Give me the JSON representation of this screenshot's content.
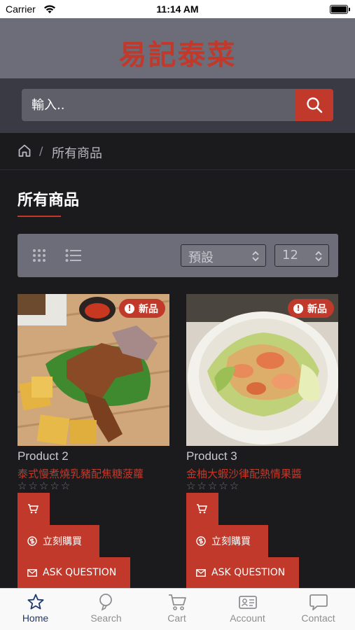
{
  "status_bar": {
    "carrier": "Carrier",
    "time": "11:14 AM"
  },
  "brand": {
    "title": "易記泰菜"
  },
  "search": {
    "placeholder": "輸入.."
  },
  "breadcrumb": {
    "separator": "/",
    "current": "所有商品"
  },
  "page": {
    "title": "所有商品"
  },
  "toolbar": {
    "sort_value": "預設",
    "count_value": "12"
  },
  "products": [
    {
      "badge": "新品",
      "name": "Product 2",
      "description": "泰式慢煮燒乳豬配焦糖菠蘿",
      "rating_stars": "☆☆☆☆☆",
      "buy_label": "立刻購買",
      "ask_label": "ASK QUESTION"
    },
    {
      "badge": "新品",
      "name": "Product 3",
      "description": "金柚大蝦沙律配熱情果醬",
      "rating_stars": "☆☆☆☆☆",
      "buy_label": "立刻購買",
      "ask_label": "ASK QUESTION"
    }
  ],
  "tabs": [
    {
      "label": "Home",
      "icon": "star-icon",
      "active": true
    },
    {
      "label": "Search",
      "icon": "search-icon",
      "active": false
    },
    {
      "label": "Cart",
      "icon": "cart-icon",
      "active": false
    },
    {
      "label": "Account",
      "icon": "account-card-icon",
      "active": false
    },
    {
      "label": "Contact",
      "icon": "chat-bubble-icon",
      "active": false
    }
  ],
  "colors": {
    "accent": "#c0392b",
    "header_bg": "#6d6d79",
    "search_bar_bg": "#3a3a44",
    "page_bg": "#1b1b1d",
    "tab_active": "#1f3a6e"
  }
}
